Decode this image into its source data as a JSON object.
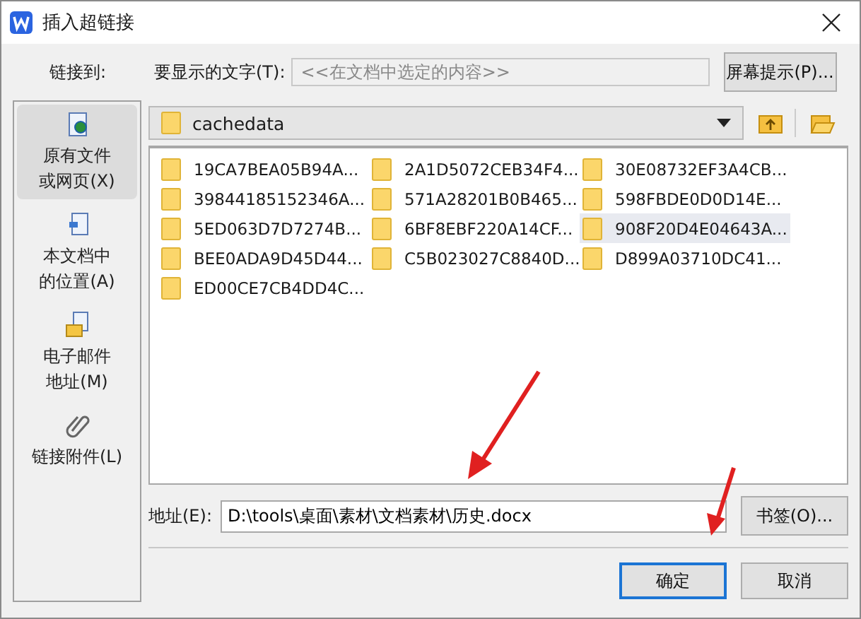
{
  "window": {
    "title": "插入超链接"
  },
  "link_to_label": "链接到:",
  "display_text": {
    "label": "要显示的文字(T):",
    "placeholder": "<<在文档中选定的内容>>"
  },
  "screen_tip_button": "屏幕提示(P)...",
  "sidebar": {
    "items": [
      {
        "label_lines": [
          "原有文件",
          "或网页(X)"
        ],
        "selected": true,
        "kind": "file"
      },
      {
        "label_lines": [
          "本文档中",
          "的位置(A)"
        ],
        "selected": false,
        "kind": "place"
      },
      {
        "label_lines": [
          "电子邮件",
          "地址(M)"
        ],
        "selected": false,
        "kind": "mail"
      },
      {
        "label_lines": [
          "链接附件(L)"
        ],
        "selected": false,
        "kind": "attach"
      }
    ]
  },
  "folder": {
    "name": "cachedata"
  },
  "files": [
    {
      "name": "19CA7BEA05B94A...",
      "selected": false
    },
    {
      "name": "2A1D5072CEB34F4...",
      "selected": false
    },
    {
      "name": "30E08732EF3A4CB...",
      "selected": false
    },
    {
      "name": "39844185152346A...",
      "selected": false
    },
    {
      "name": "571A28201B0B465...",
      "selected": false
    },
    {
      "name": "598FBDE0D0D14E...",
      "selected": false
    },
    {
      "name": "5ED063D7D7274B...",
      "selected": false
    },
    {
      "name": "6BF8EBF220A14CF...",
      "selected": false
    },
    {
      "name": "908F20D4E04643A...",
      "selected": true
    },
    {
      "name": "BEE0ADA9D45D44...",
      "selected": false
    },
    {
      "name": "C5B023027C8840D...",
      "selected": false
    },
    {
      "name": "D899A03710DC41...",
      "selected": false
    },
    {
      "name": "ED00CE7CB4DD4C...",
      "selected": false
    }
  ],
  "address": {
    "label": "地址(E):",
    "value": "D:\\tools\\桌面\\素材\\文档素材\\历史.docx"
  },
  "bookmark_button": "书签(O)...",
  "buttons": [
    {
      "label": "确定",
      "default": true
    },
    {
      "label": "取消",
      "default": false
    }
  ]
}
